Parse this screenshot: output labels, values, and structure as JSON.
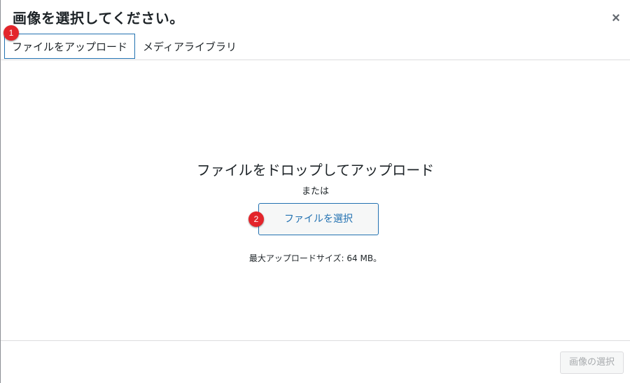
{
  "modal": {
    "title": "画像を選択してください。",
    "close_label": "×"
  },
  "tabs": [
    {
      "label": "ファイルをアップロード",
      "active": true
    },
    {
      "label": "メディアライブラリ",
      "active": false
    }
  ],
  "uploader": {
    "drop_text": "ファイルをドロップしてアップロード",
    "or_text": "または",
    "select_button": "ファイルを選択",
    "max_size": "最大アップロードサイズ: 64 MB。"
  },
  "annotations": [
    {
      "label": "1"
    },
    {
      "label": "2"
    }
  ],
  "toolbar": {
    "select_image_button": "画像の選択"
  },
  "colors": {
    "accent": "#2271b1",
    "badge": "#e3252b",
    "disabled_text": "#a7aaad"
  }
}
